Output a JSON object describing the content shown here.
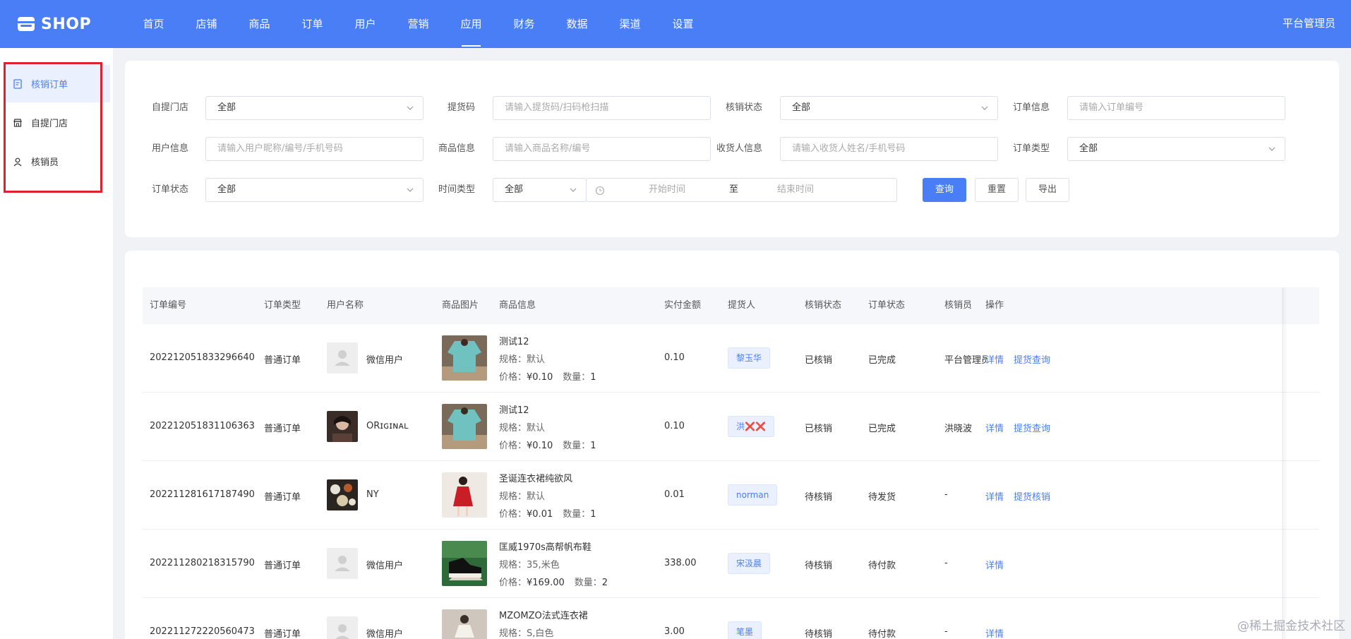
{
  "brand": {
    "name": "SHOP"
  },
  "nav": {
    "items": [
      "首页",
      "店铺",
      "商品",
      "订单",
      "用户",
      "营销",
      "应用",
      "财务",
      "数据",
      "渠道",
      "设置"
    ],
    "active_index": 6,
    "admin_label": "平台管理员"
  },
  "sidebar": {
    "items": [
      {
        "label": "核销订单",
        "icon": "document-icon",
        "active": true
      },
      {
        "label": "自提门店",
        "icon": "store-icon",
        "active": false
      },
      {
        "label": "核销员",
        "icon": "user-icon",
        "active": false
      }
    ]
  },
  "filters": {
    "store_label": "自提门店",
    "store_value": "全部",
    "pickup_code_label": "提货码",
    "pickup_code_placeholder": "请输入提货码/扫码枪扫描",
    "verify_status_label": "核销状态",
    "verify_status_value": "全部",
    "order_info_label": "订单信息",
    "order_info_placeholder": "请输入订单编号",
    "user_info_label": "用户信息",
    "user_info_placeholder": "请输入用户昵称/编号/手机号码",
    "goods_info_label": "商品信息",
    "goods_info_placeholder": "请输入商品名称/编号",
    "receiver_label": "收货人信息",
    "receiver_placeholder": "请输入收货人姓名/手机号码",
    "order_type_label": "订单类型",
    "order_type_value": "全部",
    "order_status_label": "订单状态",
    "order_status_value": "全部",
    "time_type_label": "时间类型",
    "time_type_value": "全部",
    "start_time_placeholder": "开始时间",
    "range_separator": "至",
    "end_time_placeholder": "结束时间",
    "query_label": "查询",
    "reset_label": "重置",
    "export_label": "导出"
  },
  "table": {
    "headers": [
      "订单编号",
      "订单类型",
      "用户名称",
      "商品图片",
      "商品信息",
      "实付金额",
      "提货人",
      "核销状态",
      "订单状态",
      "核销员",
      "操作"
    ],
    "spec_prefix": "规格：",
    "price_prefix": "价格：",
    "qty_prefix": "数量：",
    "rows": [
      {
        "order_no": "202212051833296640",
        "type": "普通订单",
        "user": "微信用户",
        "goods_name": "测试12",
        "spec": "默认",
        "price": "¥0.10",
        "qty": "1",
        "paid": "0.10",
        "picker": "黎玉华",
        "verify": "已核销",
        "status": "已完成",
        "verifier": "平台管理员",
        "actions": [
          "详情",
          "提货查询"
        ],
        "avatar": "default",
        "thumb": "teal"
      },
      {
        "order_no": "202212051831106363",
        "type": "普通订单",
        "user": "ORɪɢɪɴᴀʟ",
        "goods_name": "测试12",
        "spec": "默认",
        "price": "¥0.10",
        "qty": "1",
        "paid": "0.10",
        "picker": "洪❌❌",
        "verify": "已核销",
        "status": "已完成",
        "verifier": "洪晓波",
        "actions": [
          "详情",
          "提货查询"
        ],
        "avatar": "photo",
        "thumb": "teal"
      },
      {
        "order_no": "202211281617187490",
        "type": "普通订单",
        "user": "NY",
        "goods_name": "圣诞连衣裙纯欲风",
        "spec": "默认",
        "price": "¥0.01",
        "qty": "1",
        "paid": "0.01",
        "picker": "norman",
        "verify": "待核销",
        "status": "待发货",
        "verifier": "-",
        "actions": [
          "详情",
          "提货核销"
        ],
        "avatar": "food",
        "thumb": "red"
      },
      {
        "order_no": "202211280218315790",
        "type": "普通订单",
        "user": "微信用户",
        "goods_name": "匡威1970s高帮帆布鞋",
        "spec": "35,米色",
        "price": "¥169.00",
        "qty": "2",
        "paid": "338.00",
        "picker": "宋汲晨",
        "verify": "待核销",
        "status": "待付款",
        "verifier": "-",
        "actions": [
          "详情"
        ],
        "avatar": "default",
        "thumb": "shoe"
      },
      {
        "order_no": "202211272220560473",
        "type": "普通订单",
        "user": "微信用户",
        "goods_name": "MZOMZO法式连衣裙",
        "spec": "S,白色",
        "price": "",
        "qty": "",
        "paid": "3.00",
        "picker": "笔墨",
        "verify": "待核销",
        "status": "待付款",
        "verifier": "-",
        "actions": [
          "详情"
        ],
        "avatar": "default",
        "thumb": "dress"
      }
    ]
  },
  "watermark": "@稀土掘金技术社区",
  "colors": {
    "primary": "#4a7ef6",
    "highlight_border": "#e0202a"
  }
}
